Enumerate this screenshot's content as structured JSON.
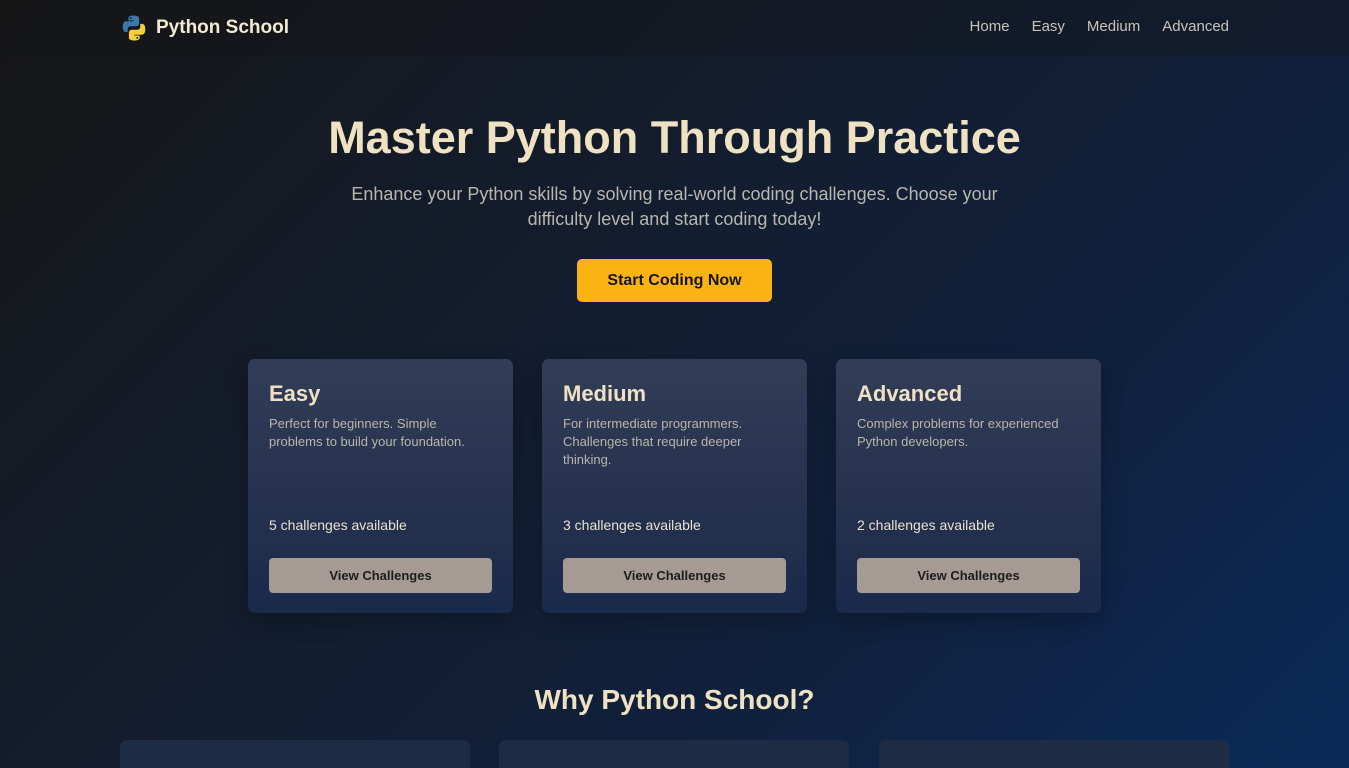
{
  "brand": {
    "name": "Python School",
    "logo_icon": "python-logo-icon"
  },
  "nav": {
    "links": [
      "Home",
      "Easy",
      "Medium",
      "Advanced"
    ]
  },
  "hero": {
    "title": "Master Python Through Practice",
    "subtitle": "Enhance your Python skills by solving real-world coding challenges. Choose your difficulty level and start coding today!",
    "cta_label": "Start Coding Now"
  },
  "levels": [
    {
      "title": "Easy",
      "description": "Perfect for beginners. Simple problems to build your foundation.",
      "count": "5 challenges available",
      "button": "View Challenges"
    },
    {
      "title": "Medium",
      "description": "For intermediate programmers. Challenges that require deeper thinking.",
      "count": "3 challenges available",
      "button": "View Challenges"
    },
    {
      "title": "Advanced",
      "description": "Complex problems for experienced Python developers.",
      "count": "2 challenges available",
      "button": "View Challenges"
    }
  ],
  "why": {
    "title": "Why Python School?"
  },
  "colors": {
    "accent": "#fbb313",
    "heading": "#efe2c3",
    "card_button": "#a69b94"
  }
}
